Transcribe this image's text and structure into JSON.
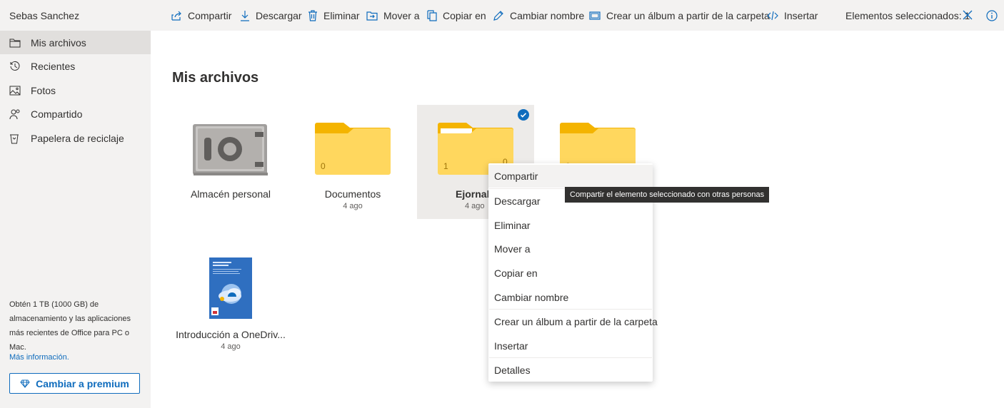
{
  "topbar": {
    "user_name": "Sebas Sanchez",
    "commands": {
      "share": "Compartir",
      "download": "Descargar",
      "delete": "Eliminar",
      "move": "Mover a",
      "copy": "Copiar en",
      "rename": "Cambiar nombre",
      "album": "Crear un álbum a partir de la carpeta",
      "embed": "Insertar"
    },
    "selected_count": "Elementos seleccionados: 1"
  },
  "sidebar": {
    "items": [
      {
        "label": "Mis archivos",
        "icon": "folder-icon",
        "active": true
      },
      {
        "label": "Recientes",
        "icon": "history-icon"
      },
      {
        "label": "Fotos",
        "icon": "image-icon"
      },
      {
        "label": "Compartido",
        "icon": "people-icon"
      },
      {
        "label": "Papelera de reciclaje",
        "icon": "recycle-bin-icon"
      }
    ],
    "promo_text": "Obtén 1 TB (1000 GB) de almacenamiento y las aplicaciones más recientes de Office para PC o Mac.",
    "promo_link": "Más información.",
    "premium_button": "Cambiar a premium"
  },
  "main": {
    "title": "Mis archivos",
    "tiles": [
      {
        "name": "Almacén personal",
        "date": "",
        "icon": "vault-icon"
      },
      {
        "name": "Documentos",
        "date": "4 ago",
        "count": "0",
        "icon": "folder-icon"
      },
      {
        "name": "Ejornal",
        "date": "4 ago",
        "count": "1",
        "count_right": "0",
        "icon": "folder-icon",
        "selected": true
      },
      {
        "name": "",
        "date": "",
        "count": "0",
        "icon": "folder-icon"
      },
      {
        "name": "Introducción a OneDriv...",
        "date": "4 ago",
        "icon": "pdf-thumbnail-icon"
      }
    ]
  },
  "context_menu": {
    "items": [
      "Compartir",
      "Descargar",
      "Eliminar",
      "Mover a",
      "Copiar en",
      "Cambiar nombre",
      "Crear un álbum a partir de la carpeta",
      "Insertar",
      "Detalles"
    ]
  },
  "tooltip": "Compartir el elemento seleccionado con otras personas",
  "colors": {
    "accent": "#0f6cbd",
    "folder_back": "#f4b400",
    "folder_front": "#ffd75e",
    "sidebar_bg": "#f3f2f1"
  }
}
